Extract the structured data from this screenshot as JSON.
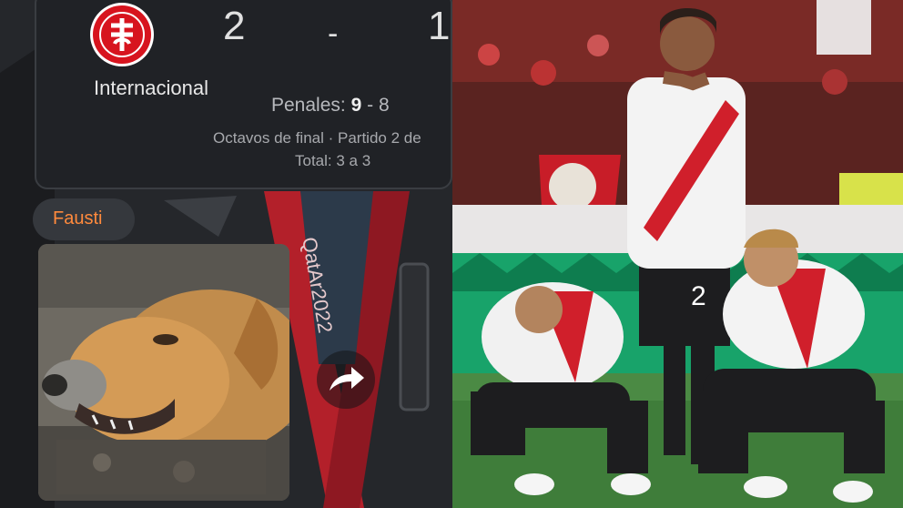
{
  "match": {
    "team_name": "Internacional",
    "score_home": "2",
    "score_separator": "-",
    "score_away": "1",
    "penalties_label": "Penales:",
    "penalties_home": "9",
    "penalties_separator": "-",
    "penalties_away": "8",
    "stage": "Octavos de final · Partido 2 de",
    "total": "Total: 3 a 3"
  },
  "post": {
    "author": "Fausti"
  },
  "colors": {
    "accent_name": "#ff8a3d",
    "club_red": "#d7141e"
  },
  "icons": {
    "crest": "internacional-crest-icon",
    "share": "share-arrow-icon"
  }
}
